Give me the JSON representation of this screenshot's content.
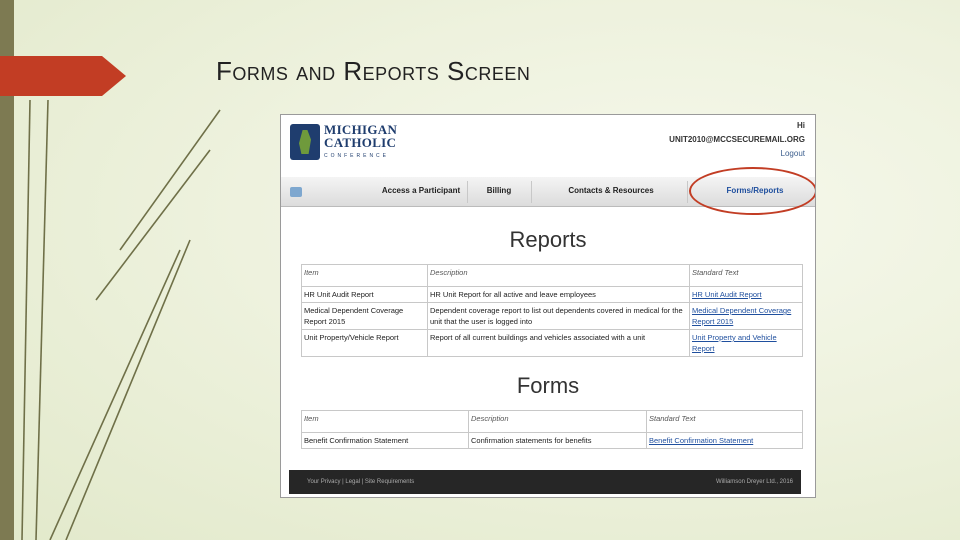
{
  "slide": {
    "title": "Forms and Reports Screen",
    "accent_color": "#c23d24"
  },
  "site": {
    "logo_name": "MICHIGAN CATHOLIC",
    "logo_sub": "CONFERENCE",
    "account": {
      "line1": "Hi",
      "email": "UNIT2010@MCCSECUREMAIL.ORG",
      "logout": "Logout"
    },
    "nav": {
      "home_icon": "home-icon",
      "items": [
        "Access a Participant",
        "Billing",
        "Contacts & Resources",
        "Forms/Reports"
      ]
    },
    "reports": {
      "heading": "Reports",
      "columns": [
        "Item",
        "Description",
        "Standard Text"
      ],
      "rows": [
        [
          "HR Unit Audit Report",
          "HR Unit Report for all active and leave employees",
          "HR Unit Audit Report"
        ],
        [
          "Medical Dependent Coverage Report 2015",
          "Dependent coverage report to list out dependents covered in medical for the unit that the user is logged into",
          "Medical Dependent Coverage Report 2015"
        ],
        [
          "Unit Property/Vehicle Report",
          "Report of all current buildings and vehicles associated with a unit",
          "Unit Property and Vehicle Report"
        ]
      ]
    },
    "forms": {
      "heading": "Forms",
      "columns": [
        "Item",
        "Description",
        "Standard Text"
      ],
      "rows": [
        [
          "Benefit Confirmation Statement",
          "Confirmation statements for benefits",
          "Benefit Confirmation Statement"
        ]
      ]
    },
    "footer": {
      "left": "Your Privacy | Legal | Site Requirements",
      "right": "Williamson Dreyer Ltd., 2016"
    }
  }
}
